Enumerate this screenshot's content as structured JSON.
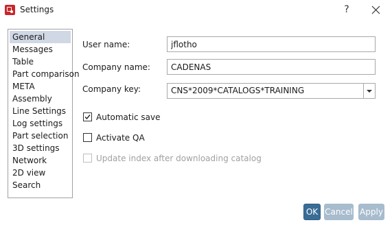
{
  "window": {
    "title": "Settings",
    "help_label": "?",
    "icon": "app-logo-icon",
    "close_icon": "close-icon"
  },
  "nav": {
    "items": [
      {
        "label": "General",
        "selected": true
      },
      {
        "label": "Messages",
        "selected": false
      },
      {
        "label": "Table",
        "selected": false
      },
      {
        "label": "Part comparison",
        "selected": false
      },
      {
        "label": "META",
        "selected": false
      },
      {
        "label": "Assembly",
        "selected": false
      },
      {
        "label": "Line Settings",
        "selected": false
      },
      {
        "label": "Log settings",
        "selected": false
      },
      {
        "label": "Part selection",
        "selected": false
      },
      {
        "label": "3D settings",
        "selected": false
      },
      {
        "label": "Network",
        "selected": false
      },
      {
        "label": "2D view",
        "selected": false
      },
      {
        "label": "Search",
        "selected": false
      }
    ]
  },
  "form": {
    "user_name_label": "User name:",
    "user_name_value": "jflotho",
    "company_name_label": "Company name:",
    "company_name_value": "CADENAS",
    "company_key_label": "Company key:",
    "company_key_value": "CNS*2009*CATALOGS*TRAINING",
    "automatic_save_label": "Automatic save",
    "automatic_save_checked": true,
    "activate_qa_label": "Activate QA",
    "activate_qa_checked": false,
    "update_index_label": "Update index after downloading catalog",
    "update_index_checked": false,
    "update_index_enabled": false
  },
  "buttons": {
    "ok_label": "OK",
    "cancel_label": "Cancel",
    "apply_label": "Apply"
  },
  "colors": {
    "selected_item_bg": "#d0d7e5",
    "primary_button": "#3a6d96",
    "disabled_button": "#a7bccd",
    "app_icon": "#c8272d"
  }
}
